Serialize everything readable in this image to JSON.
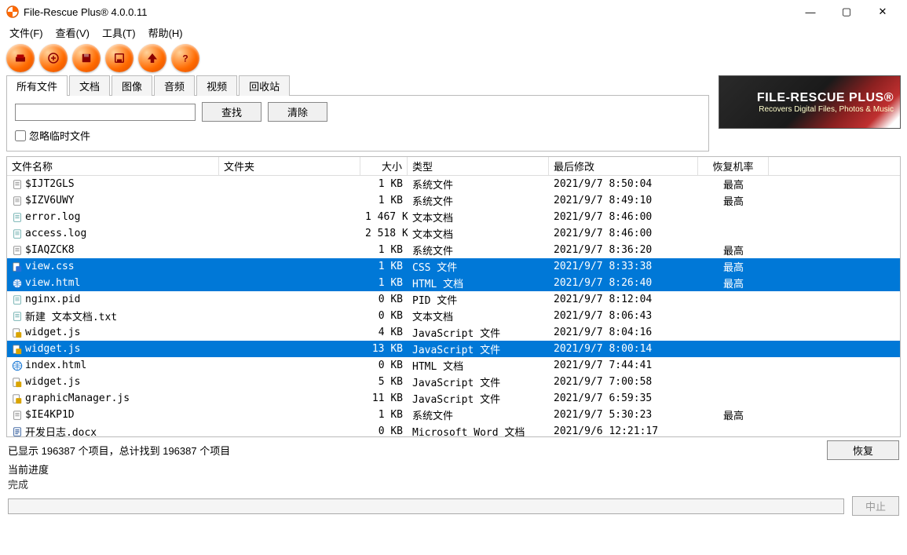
{
  "window": {
    "title": "File-Rescue Plus® 4.0.0.11"
  },
  "menu": {
    "file": "文件(F)",
    "view": "查看(V)",
    "tools": "工具(T)",
    "help": "帮助(H)"
  },
  "tabs": {
    "all": "所有文件",
    "doc": "文档",
    "img": "图像",
    "audio": "音频",
    "video": "视频",
    "recycle": "回收站"
  },
  "search": {
    "find": "查找",
    "clear": "清除",
    "ignore_temp": "忽略临时文件"
  },
  "banner": {
    "line1": "FILE-RESCUE PLUS®",
    "line2": "Recovers Digital Files, Photos & Music"
  },
  "columns": {
    "name": "文件名称",
    "folder": "文件夹",
    "size": "大小",
    "type": "类型",
    "modified": "最后修改",
    "prob": "恢复机率"
  },
  "files": [
    {
      "icon": "sys",
      "name": "$IJT2GLS",
      "folder": "",
      "size": "1 KB",
      "type": "系统文件",
      "mod": "2021/9/7 8:50:04",
      "prob": "最高",
      "sel": false
    },
    {
      "icon": "sys",
      "name": "$IZV6UWY",
      "folder": "",
      "size": "1 KB",
      "type": "系统文件",
      "mod": "2021/9/7 8:49:10",
      "prob": "最高",
      "sel": false
    },
    {
      "icon": "txt",
      "name": "error.log",
      "folder": "",
      "size": "1 467 KB",
      "type": "文本文档",
      "mod": "2021/9/7 8:46:00",
      "prob": "",
      "sel": false
    },
    {
      "icon": "txt",
      "name": "access.log",
      "folder": "",
      "size": "2 518 KB",
      "type": "文本文档",
      "mod": "2021/9/7 8:46:00",
      "prob": "",
      "sel": false
    },
    {
      "icon": "sys",
      "name": "$IAQZCK8",
      "folder": "",
      "size": "1 KB",
      "type": "系统文件",
      "mod": "2021/9/7 8:36:20",
      "prob": "最高",
      "sel": false
    },
    {
      "icon": "css",
      "name": "view.css",
      "folder": "",
      "size": "1 KB",
      "type": "CSS 文件",
      "mod": "2021/9/7 8:33:38",
      "prob": "最高",
      "sel": true
    },
    {
      "icon": "html",
      "name": "view.html",
      "folder": "",
      "size": "1 KB",
      "type": "HTML 文档",
      "mod": "2021/9/7 8:26:40",
      "prob": "最高",
      "sel": true
    },
    {
      "icon": "txt",
      "name": "nginx.pid",
      "folder": "",
      "size": "0 KB",
      "type": "PID 文件",
      "mod": "2021/9/7 8:12:04",
      "prob": "",
      "sel": false
    },
    {
      "icon": "txt",
      "name": "新建 文本文档.txt",
      "folder": "",
      "size": "0 KB",
      "type": "文本文档",
      "mod": "2021/9/7 8:06:43",
      "prob": "",
      "sel": false
    },
    {
      "icon": "js",
      "name": "widget.js",
      "folder": "",
      "size": "4 KB",
      "type": "JavaScript 文件",
      "mod": "2021/9/7 8:04:16",
      "prob": "",
      "sel": false
    },
    {
      "icon": "js",
      "name": "widget.js",
      "folder": "",
      "size": "13 KB",
      "type": "JavaScript 文件",
      "mod": "2021/9/7 8:00:14",
      "prob": "",
      "sel": true
    },
    {
      "icon": "html",
      "name": "index.html",
      "folder": "",
      "size": "0 KB",
      "type": "HTML 文档",
      "mod": "2021/9/7 7:44:41",
      "prob": "",
      "sel": false
    },
    {
      "icon": "js",
      "name": "widget.js",
      "folder": "",
      "size": "5 KB",
      "type": "JavaScript 文件",
      "mod": "2021/9/7 7:00:58",
      "prob": "",
      "sel": false
    },
    {
      "icon": "js",
      "name": "graphicManager.js",
      "folder": "",
      "size": "11 KB",
      "type": "JavaScript 文件",
      "mod": "2021/9/7 6:59:35",
      "prob": "",
      "sel": false
    },
    {
      "icon": "sys",
      "name": "$IE4KP1D",
      "folder": "",
      "size": "1 KB",
      "type": "系统文件",
      "mod": "2021/9/7 5:30:23",
      "prob": "最高",
      "sel": false
    },
    {
      "icon": "doc",
      "name": "开发日志.docx",
      "folder": "",
      "size": "0 KB",
      "type": "Microsoft Word 文档",
      "mod": "2021/9/6 12:21:17",
      "prob": "",
      "sel": false
    }
  ],
  "status": {
    "text": "已显示 196387 个项目，总计找到 196387 个项目",
    "recover": "恢复"
  },
  "progress": {
    "label": "当前进度",
    "status": "完成",
    "stop": "中止"
  }
}
